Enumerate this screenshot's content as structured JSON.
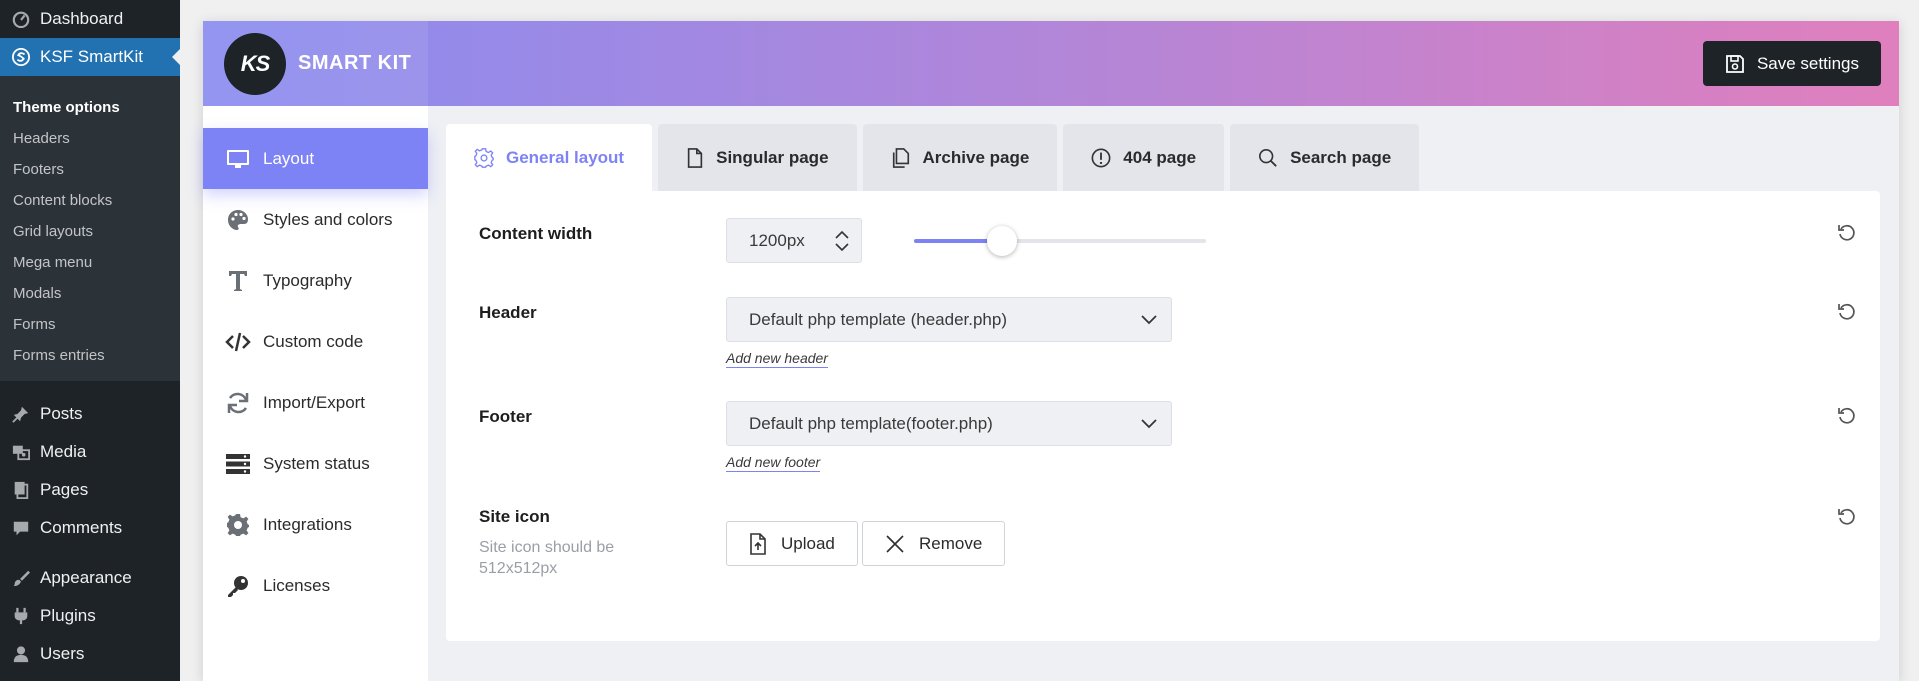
{
  "wp_menu": {
    "top": [
      {
        "label": "Dashboard",
        "icon": "dashboard-icon"
      },
      {
        "label": "KSF SmartKit",
        "icon": "smartkit-icon",
        "active": true
      }
    ],
    "submenu": [
      {
        "label": "Theme options",
        "current": true
      },
      {
        "label": "Headers"
      },
      {
        "label": "Footers"
      },
      {
        "label": "Content blocks"
      },
      {
        "label": "Grid layouts"
      },
      {
        "label": "Mega menu"
      },
      {
        "label": "Modals"
      },
      {
        "label": "Forms"
      },
      {
        "label": "Forms entries"
      }
    ],
    "group1": [
      {
        "label": "Posts",
        "icon": "pin-icon"
      },
      {
        "label": "Media",
        "icon": "media-icon"
      },
      {
        "label": "Pages",
        "icon": "pages-icon"
      },
      {
        "label": "Comments",
        "icon": "comments-icon"
      }
    ],
    "group2": [
      {
        "label": "Appearance",
        "icon": "brush-icon"
      },
      {
        "label": "Plugins",
        "icon": "plugin-icon"
      },
      {
        "label": "Users",
        "icon": "user-icon"
      }
    ]
  },
  "header": {
    "logo_text": "KS",
    "brand_name": "SMART KIT",
    "save_label": "Save settings"
  },
  "plugin_nav": [
    {
      "label": "Layout",
      "icon": "monitor-icon",
      "active": true
    },
    {
      "label": "Styles and colors",
      "icon": "palette-icon"
    },
    {
      "label": "Typography",
      "icon": "typography-icon"
    },
    {
      "label": "Custom code",
      "icon": "code-icon"
    },
    {
      "label": "Import/Export",
      "icon": "sync-icon"
    },
    {
      "label": "System status",
      "icon": "server-icon"
    },
    {
      "label": "Integrations",
      "icon": "gear-icon"
    },
    {
      "label": "Licenses",
      "icon": "key-icon"
    }
  ],
  "tabs": [
    {
      "label": "General layout",
      "icon": "gear-icon",
      "active": true
    },
    {
      "label": "Singular page",
      "icon": "file-icon"
    },
    {
      "label": "Archive page",
      "icon": "files-icon"
    },
    {
      "label": "404 page",
      "icon": "alert-icon"
    },
    {
      "label": "Search page",
      "icon": "search-icon"
    }
  ],
  "settings": {
    "content_width": {
      "label": "Content width",
      "value": "1200px",
      "slider_fraction": 0.3
    },
    "header": {
      "label": "Header",
      "selected": "Default php template (header.php)",
      "add_link": "Add new header"
    },
    "footer": {
      "label": "Footer",
      "selected": "Default php template(footer.php)",
      "add_link": "Add new footer"
    },
    "site_icon": {
      "label": "Site icon",
      "hint": "Site icon should be 512x512px",
      "upload_label": "Upload",
      "remove_label": "Remove"
    }
  },
  "colors": {
    "accent": "#7d83f5",
    "wp_active": "#2271b1",
    "wp_sidebar": "#1d2327"
  }
}
